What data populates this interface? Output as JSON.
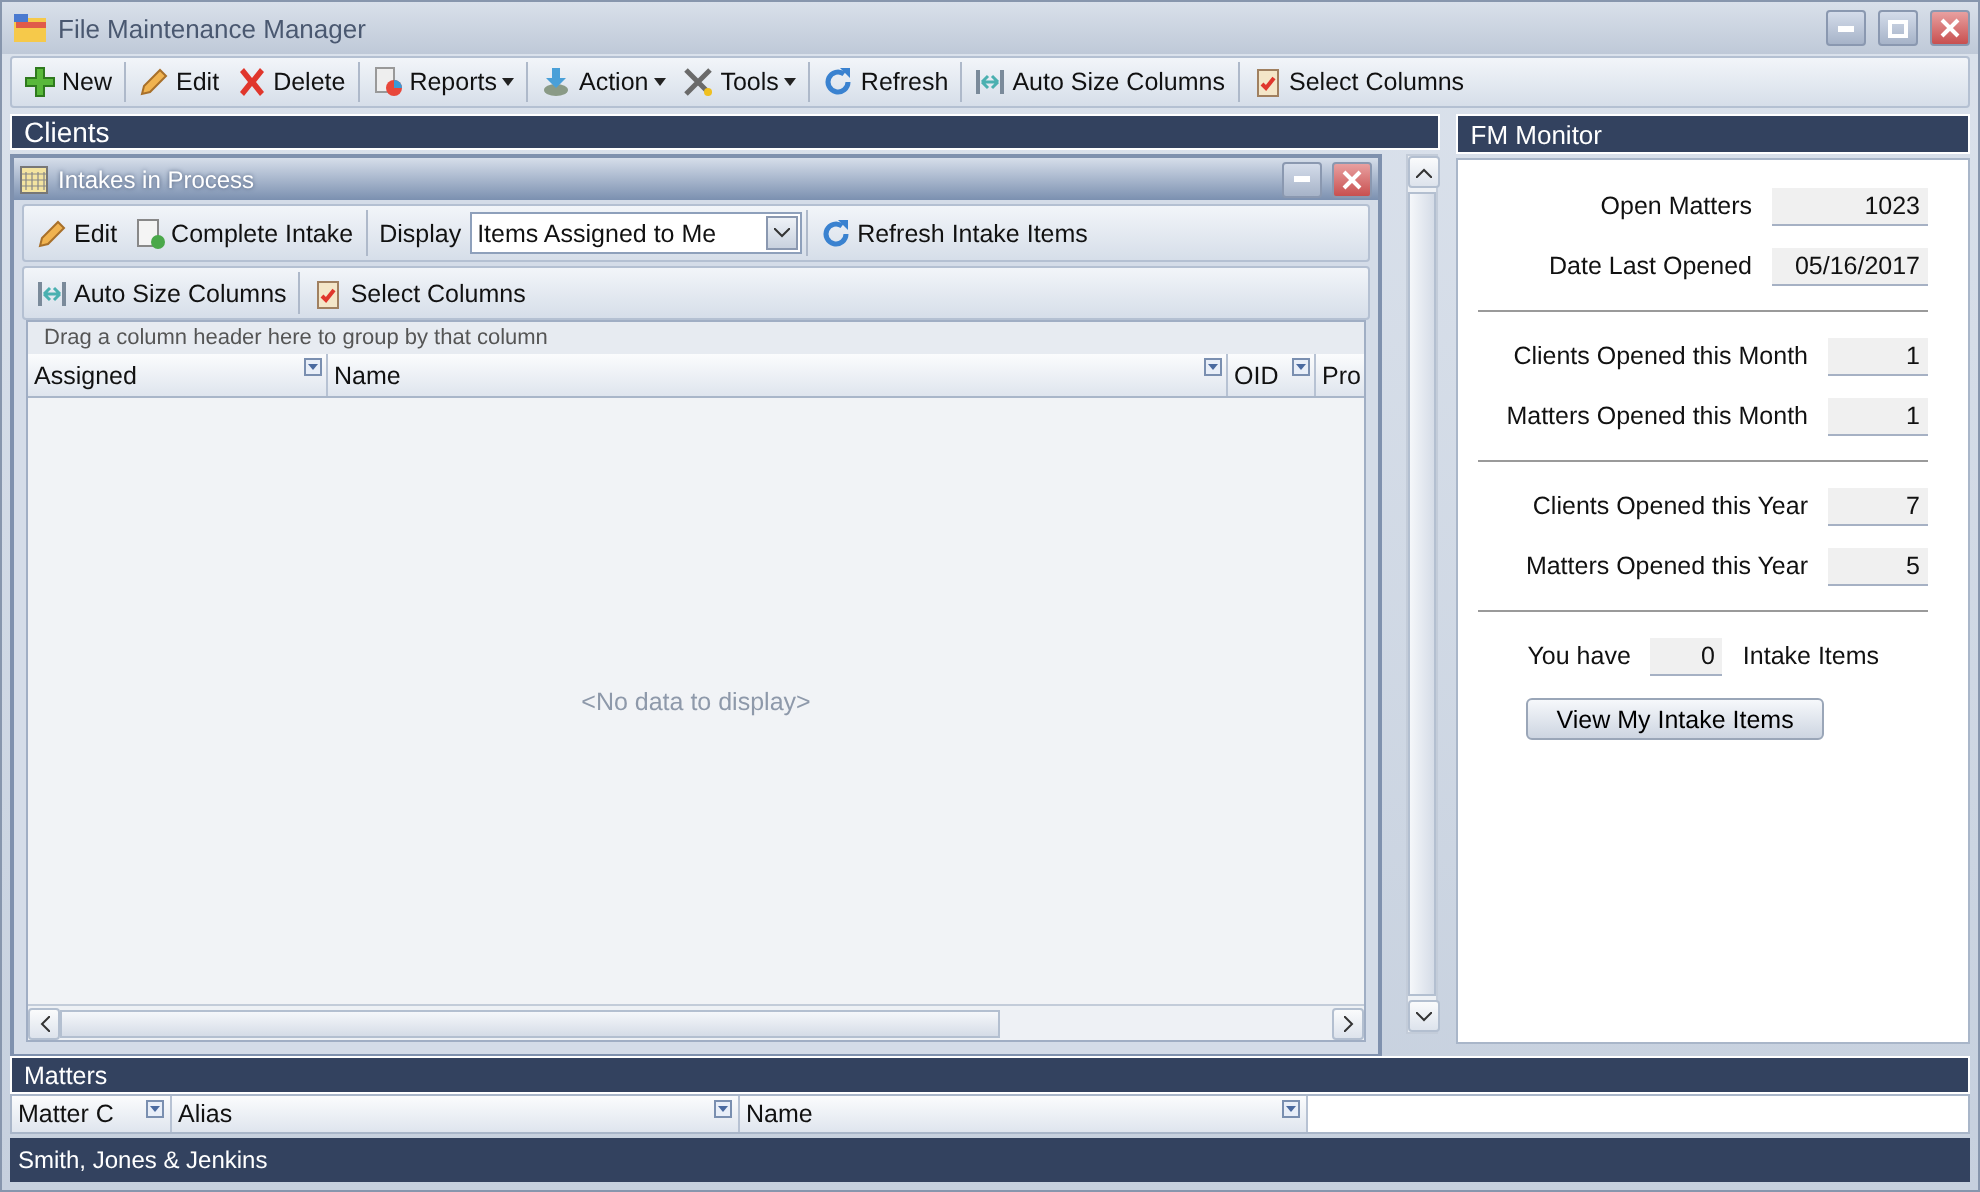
{
  "window": {
    "title": "File Maintenance Manager"
  },
  "toolbar": [
    {
      "kind": "button",
      "label": "New"
    },
    {
      "kind": "button",
      "label": "Edit"
    },
    {
      "kind": "button",
      "label": "Delete"
    },
    {
      "kind": "menu",
      "label": "Reports"
    },
    {
      "kind": "menu",
      "label": "Action"
    },
    {
      "kind": "menu",
      "label": "Tools"
    },
    {
      "kind": "button",
      "label": "Refresh"
    },
    {
      "kind": "button",
      "label": "Auto Size Columns"
    },
    {
      "kind": "button",
      "label": "Select Columns"
    }
  ],
  "clients": {
    "title": "Clients"
  },
  "intakes_window": {
    "title": "Intakes in Process",
    "toolbar": [
      {
        "kind": "button",
        "label": "Edit"
      },
      {
        "kind": "button",
        "label": "Complete Intake"
      },
      {
        "kind": "select",
        "label": "Display",
        "value": "Items Assigned to Me"
      },
      {
        "kind": "button",
        "label": "Refresh Intake Items"
      }
    ],
    "toolbar2": [
      "Auto Size Columns",
      "Select Columns"
    ],
    "group_hint": "Drag a column header here to group by that column",
    "columns": [
      "Assigned",
      "Name",
      "OID",
      "Pro"
    ],
    "empty_text": "<No data to display>"
  },
  "fm_monitor": {
    "title": "FM Monitor",
    "groups": [
      [
        {
          "label": "Open Matters",
          "value": "1023"
        },
        {
          "label": "Date Last Opened",
          "value": "05/16/2017"
        }
      ],
      [
        {
          "label": "Clients Opened this Month",
          "value": "1"
        },
        {
          "label": "Matters Opened this Month",
          "value": "1"
        }
      ],
      [
        {
          "label": "Clients Opened this Year",
          "value": "7"
        },
        {
          "label": "Matters Opened this Year",
          "value": "5"
        }
      ]
    ],
    "intake": {
      "prefix": "You have",
      "value": "0",
      "suffix": "Intake Items"
    },
    "button": "View My Intake Items"
  },
  "matters": {
    "title": "Matters",
    "columns": [
      "Matter C",
      "Alias",
      "Name"
    ]
  },
  "status_bar": "Smith, Jones & Jenkins"
}
